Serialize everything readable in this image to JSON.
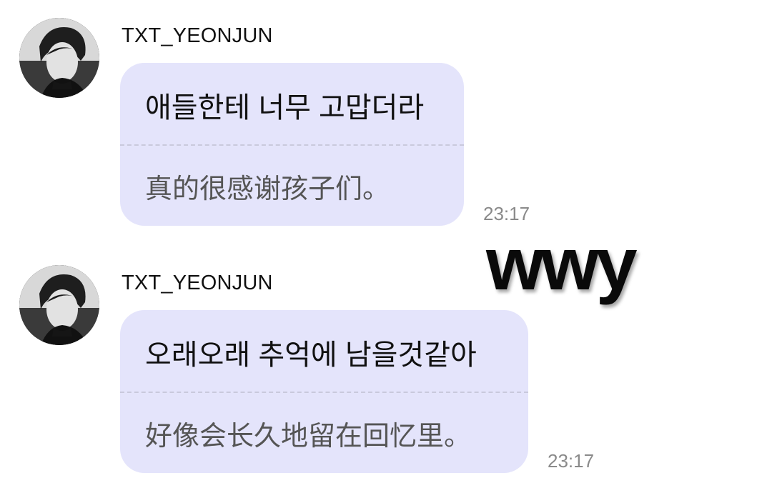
{
  "messages": [
    {
      "sender": "TXT_YEONJUN",
      "original": "애들한테 너무 고맙더라",
      "translation": "真的很感谢孩子们。",
      "time": "23:17"
    },
    {
      "sender": "TXT_YEONJUN",
      "original": "오래오래 추억에 남을것같아",
      "translation": "好像会长久地留在回忆里。",
      "time": "23:17"
    }
  ],
  "watermark": "wwy",
  "colors": {
    "bubble": "#e4e4fb",
    "divider": "#c9c9dc",
    "time": "#8a8a8a"
  }
}
